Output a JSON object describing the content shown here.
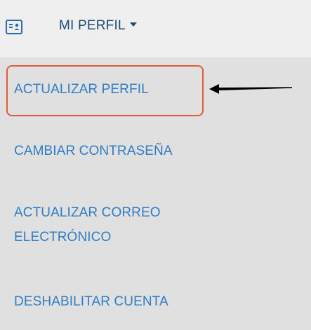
{
  "header": {
    "icon": "profile-card-icon",
    "label": "MI PERFIL"
  },
  "menu": {
    "items": [
      {
        "label": "ACTUALIZAR PERFIL",
        "highlighted": true
      },
      {
        "label": "CAMBIAR CONTRASEÑA"
      },
      {
        "label_line1": "ACTUALIZAR CORREO",
        "label_line2": "ELECTRÓNICO"
      },
      {
        "label": "DESHABILITAR CUENTA"
      }
    ]
  },
  "annotation": {
    "highlight_color": "#e05a3c",
    "arrow_color": "#000000"
  },
  "colors": {
    "header_bg": "#efefef",
    "menu_bg": "#e0e0e0",
    "link": "#2f7dc4",
    "header_text": "#1c4a73"
  }
}
